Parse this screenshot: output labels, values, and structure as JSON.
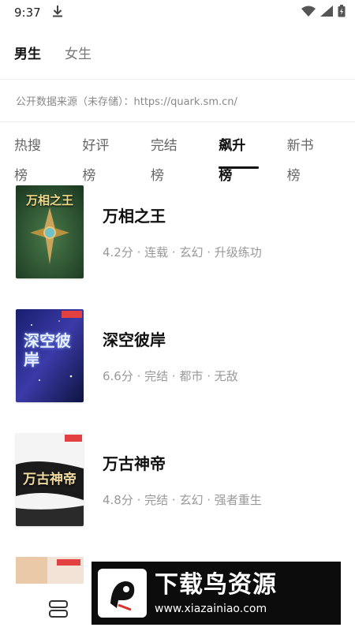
{
  "status_bar": {
    "time": "9:37",
    "icons": [
      "download-icon",
      "wifi-icon",
      "signal-icon",
      "battery-icon"
    ]
  },
  "gender_tabs": [
    {
      "label": "男生",
      "active": true
    },
    {
      "label": "女生",
      "active": false
    }
  ],
  "source_note": "公开数据来源（未存储）：https://quark.sm.cn/",
  "rank_tabs": [
    {
      "label": "热搜榜",
      "active": false
    },
    {
      "label": "好评榜",
      "active": false
    },
    {
      "label": "完结榜",
      "active": false
    },
    {
      "label": "飙升榜",
      "active": true
    },
    {
      "label": "新书榜",
      "active": false
    }
  ],
  "books": [
    {
      "title": "万相之王",
      "meta": "4.2分 · 连载 · 玄幻 · 升级练功",
      "cover_text": "万相之王"
    },
    {
      "title": "深空彼岸",
      "meta": "6.6分 · 完结 · 都市 · 无敌",
      "cover_text": "深空彼岸"
    },
    {
      "title": "万古神帝",
      "meta": "4.8分 · 完结 · 玄幻 · 强者重生",
      "cover_text": "万古神帝"
    }
  ],
  "bottom_nav": {
    "icon": "menu-stack-icon"
  },
  "watermark": {
    "title": "下载鸟资源",
    "url": "www.xiazainiao.com"
  },
  "colors": {
    "active_text": "#111111",
    "inactive_text": "#666666",
    "meta_text": "#999999",
    "indicator": "#111111"
  }
}
